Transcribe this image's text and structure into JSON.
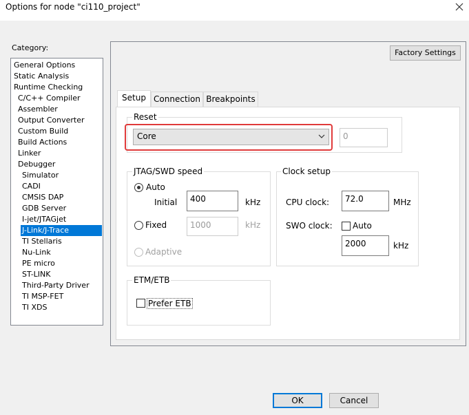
{
  "window": {
    "title": "Options for node \"ci110_project\"",
    "close_icon": "close-icon"
  },
  "category": {
    "label": "Category:",
    "items": [
      {
        "label": "General Options",
        "indent": 0
      },
      {
        "label": "Static Analysis",
        "indent": 0
      },
      {
        "label": "Runtime Checking",
        "indent": 0
      },
      {
        "label": "C/C++ Compiler",
        "indent": 1
      },
      {
        "label": "Assembler",
        "indent": 1
      },
      {
        "label": "Output Converter",
        "indent": 1
      },
      {
        "label": "Custom Build",
        "indent": 1
      },
      {
        "label": "Build Actions",
        "indent": 1
      },
      {
        "label": "Linker",
        "indent": 1
      },
      {
        "label": "Debugger",
        "indent": 1
      },
      {
        "label": "Simulator",
        "indent": 2
      },
      {
        "label": "CADI",
        "indent": 2
      },
      {
        "label": "CMSIS DAP",
        "indent": 2
      },
      {
        "label": "GDB Server",
        "indent": 2
      },
      {
        "label": "I-jet/JTAGjet",
        "indent": 2
      },
      {
        "label": "J-Link/J-Trace",
        "indent": 2,
        "selected": true
      },
      {
        "label": "TI Stellaris",
        "indent": 2
      },
      {
        "label": "Nu-Link",
        "indent": 2
      },
      {
        "label": "PE micro",
        "indent": 2
      },
      {
        "label": "ST-LINK",
        "indent": 2
      },
      {
        "label": "Third-Party Driver",
        "indent": 2
      },
      {
        "label": "TI MSP-FET",
        "indent": 2
      },
      {
        "label": "TI XDS",
        "indent": 2
      }
    ]
  },
  "factory_settings_label": "Factory Settings",
  "tabs": [
    {
      "label": "Setup",
      "active": true
    },
    {
      "label": "Connection",
      "active": false
    },
    {
      "label": "Breakpoints",
      "active": false
    }
  ],
  "reset": {
    "title": "Reset",
    "selected": "Core",
    "delay_value": "0"
  },
  "jtag": {
    "title": "JTAG/SWD speed",
    "auto_label": "Auto",
    "initial_label": "Initial",
    "initial_value": "400",
    "initial_unit": "kHz",
    "fixed_label": "Fixed",
    "fixed_value": "1000",
    "fixed_unit": "kHz",
    "adaptive_label": "Adaptive"
  },
  "clock": {
    "title": "Clock setup",
    "cpu_label": "CPU clock:",
    "cpu_value": "72.0",
    "cpu_unit": "MHz",
    "swo_label": "SWO clock:",
    "swo_auto_label": "Auto",
    "swo_value": "2000",
    "swo_unit": "kHz"
  },
  "etm": {
    "title": "ETM/ETB",
    "prefer_etb_label": "Prefer ETB"
  },
  "footer": {
    "ok_label": "OK",
    "cancel_label": "Cancel"
  },
  "colors": {
    "selection": "#0078d7",
    "highlight_frame": "#e03a3a"
  }
}
